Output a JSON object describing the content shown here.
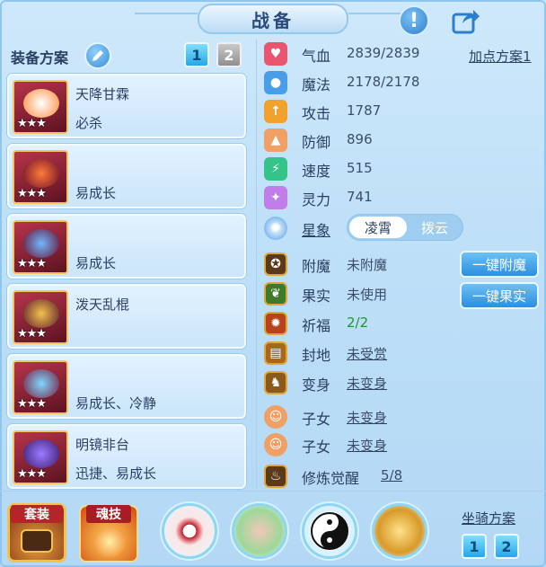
{
  "window": {
    "title": "战备"
  },
  "equipment": {
    "plan_label": "装备方案",
    "plan_buttons": [
      "1",
      "2"
    ],
    "items": [
      {
        "name": "天降甘霖",
        "trait": "必杀",
        "stars": "★★★",
        "color": "#c8e0ff"
      },
      {
        "name": "",
        "trait": "易成长",
        "stars": "★★★",
        "color": "#ff6a3a"
      },
      {
        "name": "",
        "trait": "易成长",
        "stars": "★★★",
        "color": "#6fb7ff"
      },
      {
        "name": "泼天乱棍",
        "trait": "",
        "stars": "★★★",
        "color": "#f2c14e"
      },
      {
        "name": "",
        "trait": "易成长、冷静",
        "stars": "★★★",
        "color": "#7fd7ff"
      },
      {
        "name": "明镜非台",
        "trait": "迅捷、易成长",
        "stars": "★★★",
        "color": "#9b7bff"
      }
    ]
  },
  "stats": {
    "add_plan_label": "加点方案1",
    "rows": [
      {
        "label": "气血",
        "value": "2839/2839",
        "icon": "heart-icon",
        "color": "#e8556f"
      },
      {
        "label": "魔法",
        "value": "2178/2178",
        "icon": "mana-icon",
        "color": "#4a9ee8"
      },
      {
        "label": "攻击",
        "value": "1787",
        "icon": "sword-icon",
        "color": "#f0a22c"
      },
      {
        "label": "防御",
        "value": "896",
        "icon": "shield-icon",
        "color": "#f0a064"
      },
      {
        "label": "速度",
        "value": "515",
        "icon": "lightning-icon",
        "color": "#34c48a"
      },
      {
        "label": "灵力",
        "value": "741",
        "icon": "spirit-icon",
        "color": "#c17ee8"
      }
    ],
    "star_label": "星象",
    "star_options": [
      "凌霄",
      "拨云"
    ]
  },
  "enhance": {
    "rows": [
      {
        "label": "附魔",
        "value": "未附魔",
        "icon": "enchant-icon",
        "style": "plain"
      },
      {
        "label": "果实",
        "value": "未使用",
        "icon": "fruit-icon",
        "style": "plain"
      },
      {
        "label": "祈福",
        "value": "2/2",
        "icon": "blessing-icon",
        "style": "green"
      },
      {
        "label": "封地",
        "value": "未受赏",
        "icon": "fief-icon",
        "style": "link"
      },
      {
        "label": "变身",
        "value": "未变身",
        "icon": "transform-icon",
        "style": "link"
      },
      {
        "label": "子女",
        "value": "未变身",
        "icon": "child-icon",
        "style": "link"
      },
      {
        "label": "子女",
        "value": "未变身",
        "icon": "child-icon",
        "style": "link"
      },
      {
        "label": "修炼觉醒",
        "value": "5/8",
        "icon": "cultivation-icon",
        "style": "link"
      }
    ],
    "enchant_button": "一键附魔",
    "fruit_button": "一键果实"
  },
  "bottom": {
    "suit_label": "套装",
    "soul_label": "魂技",
    "mount_plan_label": "坐骑方案",
    "mount_buttons": [
      "1",
      "2"
    ]
  }
}
